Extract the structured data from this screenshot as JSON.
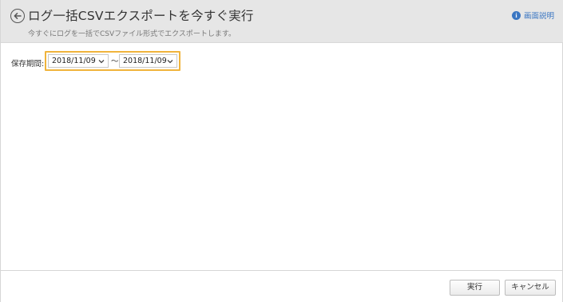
{
  "header": {
    "title": "ログ一括CSVエクスポートを今すぐ実行",
    "subtitle": "今すぐにログを一括でCSVファイル形式でエクスポートします。",
    "back_icon": "arrow-left-circle-icon",
    "help": {
      "icon": "info-icon",
      "icon_glyph": "i",
      "label": "画面説明"
    }
  },
  "form": {
    "period_label": "保存期間:",
    "from_date": "2018/11/09",
    "separator": "～",
    "to_date": "2018/11/09",
    "highlight_color": "#f0b43c"
  },
  "footer": {
    "run_label": "実行",
    "cancel_label": "キャンセル"
  }
}
